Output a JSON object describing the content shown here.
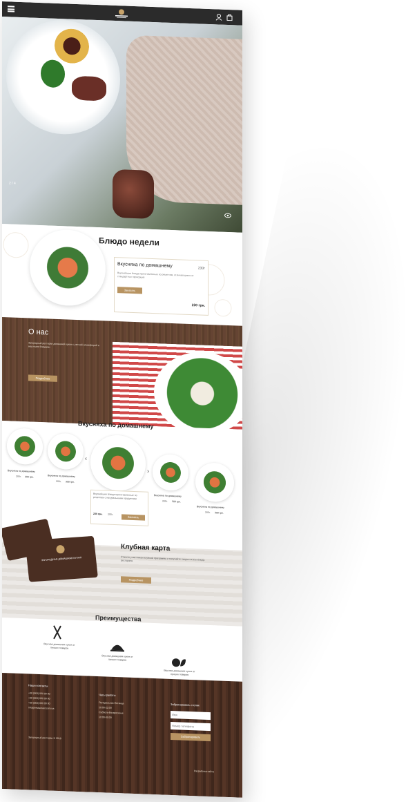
{
  "hero": {
    "slide_indicator": "2 / 4"
  },
  "dish_of_week": {
    "title": "Блюдо недели",
    "dish_name": "Вкусняха по домашнему",
    "weight": "230г",
    "description": "Вкуснейшие блюда приготовленные по рецептам, отличающиеся от стандартных пропорций",
    "button": "Заказать",
    "price": "230 грн."
  },
  "about": {
    "title": "О нас",
    "text": "Загородный ресторан домашней кухни с уютной атмосферой и вкусными блюдами",
    "button": "Подробнее"
  },
  "menu": {
    "title": "Вкусняха по домашнему",
    "items": [
      {
        "name": "Вкусняха по домашнему",
        "weight": "200г.",
        "price": "300 грн."
      },
      {
        "name": "Вкусняха по домашнему",
        "weight": "200г.",
        "price": "300 грн."
      },
      {
        "name": "Вкусняха по домашнему",
        "weight": "200г.",
        "price": "300 грн."
      },
      {
        "name": "Вкусняха по домашнему",
        "weight": "200г.",
        "price": "300 грн."
      }
    ],
    "featured": {
      "description": "Вкуснейшие блюда приготовленные по рецептам с натуральными продуктами",
      "price": "230 грн.",
      "weight": "200г.",
      "button": "Заказать"
    },
    "prev_arrow": "‹",
    "next_arrow": "›"
  },
  "club": {
    "title": "Клубная карта",
    "text": "Станьте участником клубной программы и получайте скидки на все блюда ресторана",
    "button": "Подробнее",
    "card_logo_text": "ЗАГОРОДНАЯ ДОМАШНЯЯ КУХНЯ"
  },
  "advantages": {
    "title": "Преимущества",
    "items": [
      {
        "icon": "fork-knife-icon",
        "text": "Вкусная домашняя кухня от лучших поваров"
      },
      {
        "icon": "cloche-icon",
        "text": "Вкусная домашняя кухня от лучших поваров"
      },
      {
        "icon": "vegetables-icon",
        "text": "Вкусная домашняя кухня от лучших поваров"
      }
    ]
  },
  "footer": {
    "contacts_title": "Наши контакты",
    "contacts": [
      "+38 (063) 000 00 00",
      "+38 (063) 000 00 00",
      "+38 (063) 000 00 00",
      "info@restaurant.com.ua"
    ],
    "hours_title": "Часы работы",
    "hours": [
      "Понедельник-Пятница",
      "10:00-22:00",
      "Суббота-Воскресенье",
      "10:00-00:00"
    ],
    "booking_title": "Забронировать столик",
    "name_placeholder": "Имя",
    "phone_placeholder": "Номер телефона",
    "booking_button": "Забронировать",
    "copyright": "Загородный ресторан © 2018",
    "dev": "Разработка сайта"
  },
  "colors": {
    "accent": "#b89462",
    "dark": "#2b2b2b",
    "wood": "#4b2f22"
  }
}
